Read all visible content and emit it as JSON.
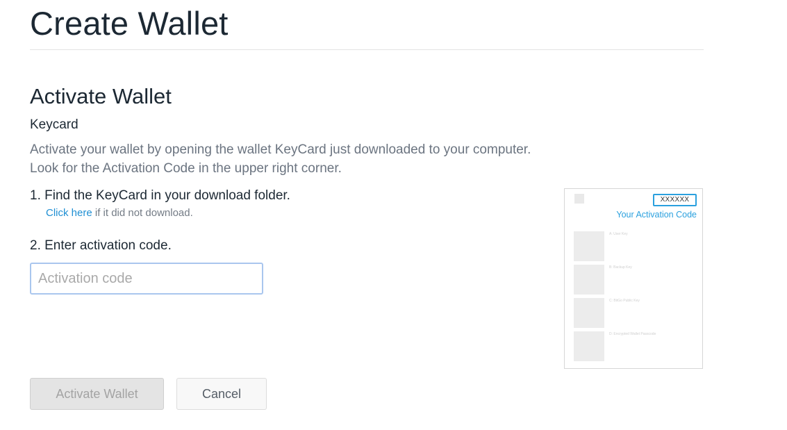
{
  "header": {
    "title": "Create Wallet"
  },
  "section": {
    "title": "Activate Wallet",
    "subtitle": "Keycard",
    "description_line1": "Activate your wallet by opening the wallet KeyCard just downloaded to your computer.",
    "description_line2": "Look for the Activation Code in the upper right corner."
  },
  "steps": {
    "step1": "1. Find the KeyCard in your download folder.",
    "step1_link": "Click here",
    "step1_hint": " if it did not download.",
    "step2": "2. Enter activation code."
  },
  "input": {
    "value": "",
    "placeholder": "Activation code"
  },
  "buttons": {
    "activate": "Activate Wallet",
    "cancel": "Cancel"
  },
  "keycard_preview": {
    "code": "XXXXXX",
    "code_label": "Your Activation Code",
    "rows": [
      "A: User Key",
      "B: Backup Key",
      "C: BitGo Public Key",
      "D: Encrypted Wallet Passcode"
    ]
  },
  "colors": {
    "link": "#1f8fd3",
    "accent": "#2aa0de",
    "input_border": "#a9c6ee",
    "disabled_button": "#e4e4e4"
  }
}
